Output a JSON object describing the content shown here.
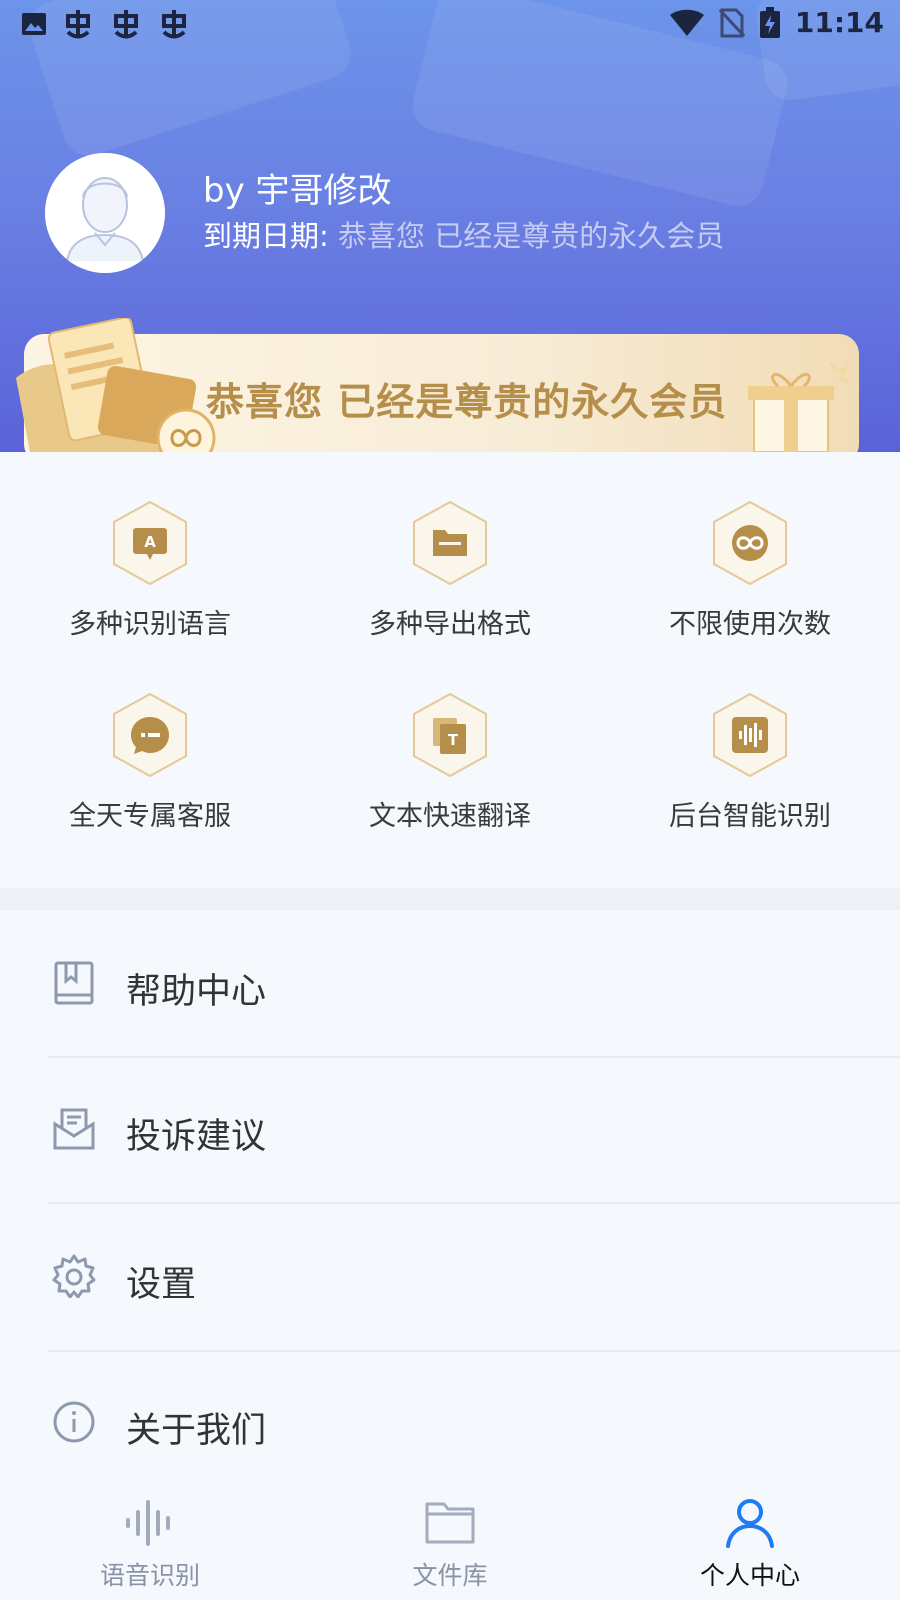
{
  "status_bar": {
    "time": "11:14",
    "left_icons": [
      "image-icon",
      "bug-icon",
      "bug-icon",
      "bug-icon"
    ],
    "right_icons": [
      "wifi-icon",
      "no-sim-icon",
      "battery-charging-icon"
    ]
  },
  "profile": {
    "user_name": "by 宇哥修改",
    "expiry_label": "到期日期:",
    "expiry_value": "恭喜您 已经是尊贵的永久会员"
  },
  "vip_banner": {
    "text": "恭喜您 已经是尊贵的永久会员"
  },
  "features": [
    {
      "label": "多种识别语言",
      "icon": "language-icon"
    },
    {
      "label": "多种导出格式",
      "icon": "folder-icon"
    },
    {
      "label": "不限使用次数",
      "icon": "infinity-icon"
    },
    {
      "label": "全天专属客服",
      "icon": "chat-icon"
    },
    {
      "label": "文本快速翻译",
      "icon": "translate-icon"
    },
    {
      "label": "后台智能识别",
      "icon": "audio-wave-icon"
    }
  ],
  "menu": [
    {
      "label": "帮助中心",
      "icon": "book-icon"
    },
    {
      "label": "投诉建议",
      "icon": "mail-icon"
    },
    {
      "label": "设置",
      "icon": "gear-icon"
    },
    {
      "label": "关于我们",
      "icon": "info-icon"
    }
  ],
  "tabs": [
    {
      "label": "语音识别",
      "icon": "voice-icon",
      "active": false
    },
    {
      "label": "文件库",
      "icon": "folder-icon",
      "active": false
    },
    {
      "label": "个人中心",
      "icon": "person-icon",
      "active": true
    }
  ],
  "colors": {
    "header_top": "#6c94ea",
    "header_bottom": "#5a63d8",
    "gold": "#b58e4a",
    "active_tab": "#1f7cf2",
    "inactive_tab": "#8a93a6"
  }
}
